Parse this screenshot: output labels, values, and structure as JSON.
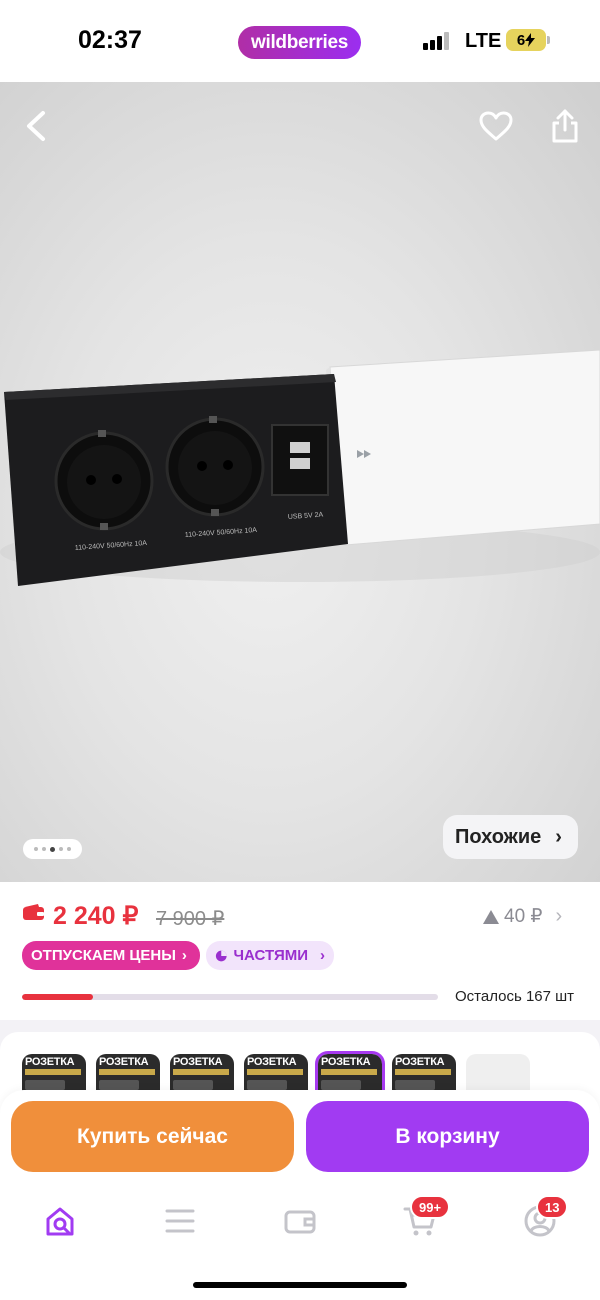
{
  "status_bar": {
    "time": "02:37",
    "brand": "wildberries",
    "network": "LTE",
    "battery": "6"
  },
  "hero": {
    "socket_label_1": "110-240V 50/60Hz 10A",
    "socket_label_2": "110-240V 50/60Hz 10A",
    "usb_label": "USB 5V 2A",
    "similar_label": "Похожие",
    "pager": {
      "count": 5,
      "active_index": 2
    }
  },
  "price": {
    "current": "2 240 ₽",
    "old": "7 900 ₽",
    "rating_value": "40 ₽",
    "badge_sale": "ОТПУСКАЕМ ЦЕНЫ",
    "badge_parts": "ЧАСТЯМИ",
    "stock_text": "Осталось 167 шт",
    "stock_fraction": 0.17
  },
  "variants": {
    "thumb_title": "РОЗЕТКА",
    "items": [
      {
        "selected": false
      },
      {
        "selected": false
      },
      {
        "selected": false
      },
      {
        "selected": false
      },
      {
        "selected": true
      },
      {
        "selected": false
      }
    ]
  },
  "actions": {
    "buy_now": "Купить сейчас",
    "add_to_cart": "В корзину"
  },
  "tabbar": {
    "cart_badge": "99+",
    "profile_badge": "13"
  },
  "colors": {
    "brand_purple": "#a13bf2",
    "buy_orange": "#f08f3b",
    "price_red": "#e8323e",
    "sale_pink": "#e0329a"
  }
}
